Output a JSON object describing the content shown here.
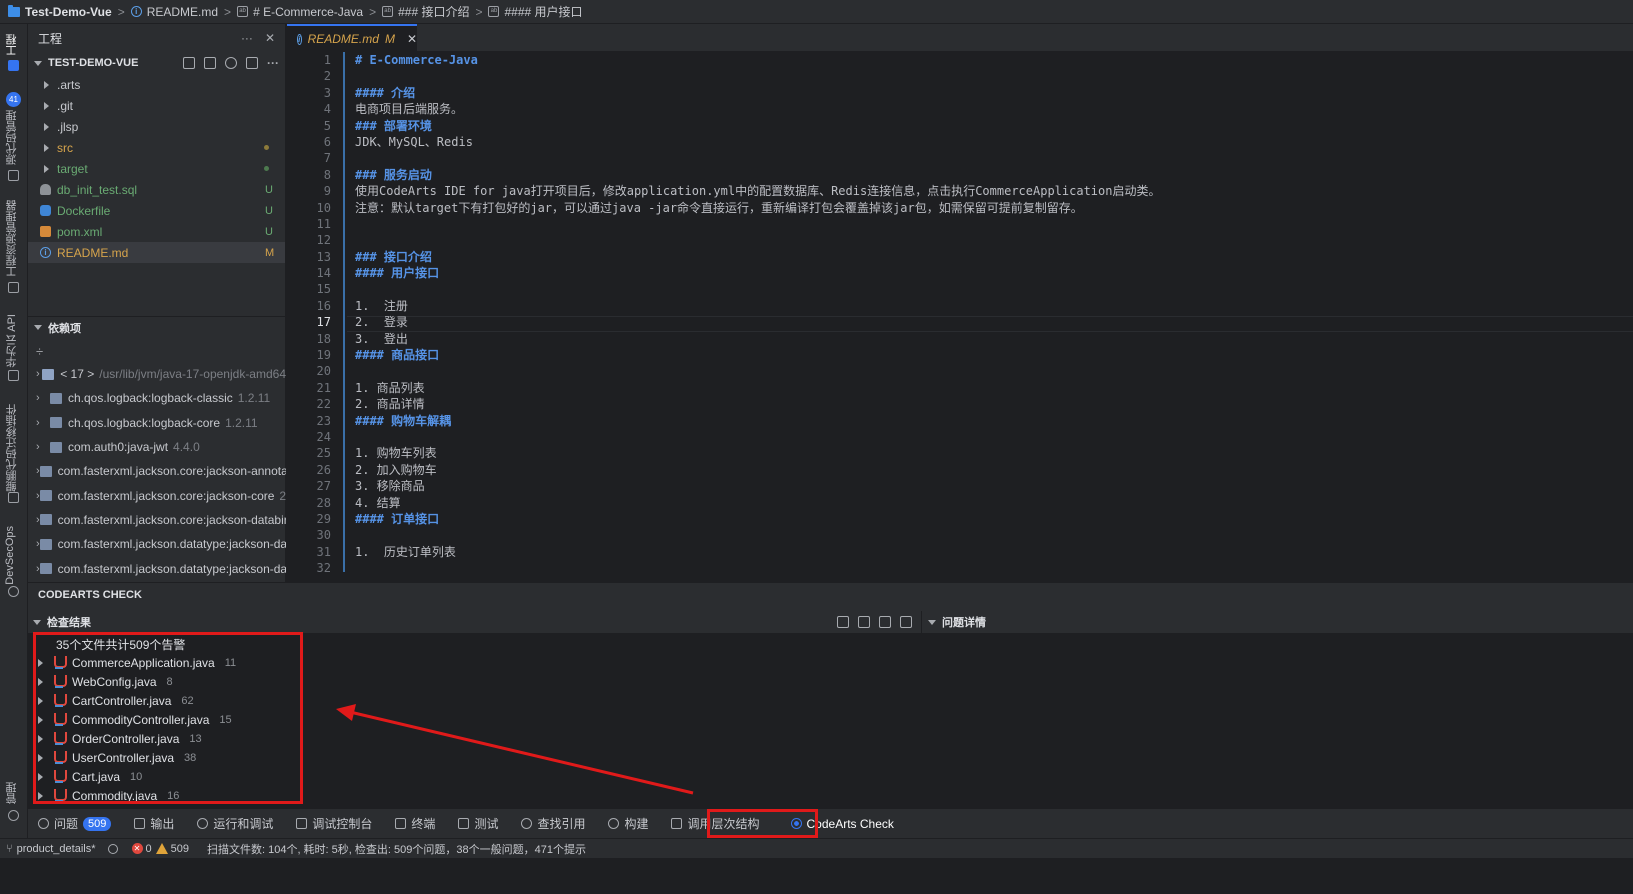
{
  "breadcrumb": {
    "root": "Test-Demo-Vue",
    "items": [
      "README.md",
      "# E-Commerce-Java",
      "### 接口介绍",
      "#### 用户接口"
    ]
  },
  "activity": {
    "project_label": "工程",
    "scm_label": "源代码管理",
    "scm_badge": "41",
    "resource_label": "工程资源管理器",
    "api_label": "华为云 API",
    "migrate_label": "鲲鹏代码迁移插件",
    "devsecops_label": "DevSecOps",
    "manage_label": "管理"
  },
  "project": {
    "title": "工程",
    "more": "···",
    "close": "✕",
    "root": "TEST-DEMO-VUE",
    "root_more": "···",
    "files": [
      {
        "name": ".arts",
        "badge": ""
      },
      {
        "name": ".git",
        "badge": ""
      },
      {
        "name": ".jlsp",
        "badge": ""
      },
      {
        "name": "src",
        "badge": ""
      },
      {
        "name": "target",
        "badge": ""
      },
      {
        "name": "db_init_test.sql",
        "badge": "U"
      },
      {
        "name": "Dockerfile",
        "badge": "U"
      },
      {
        "name": "pom.xml",
        "badge": "U"
      },
      {
        "name": "README.md",
        "badge": "M"
      }
    ],
    "deps_title": "依赖项",
    "deps_tool": "÷",
    "deps": [
      {
        "name": "< 17 >",
        "ver": "/usr/lib/jvm/java-17-openjdk-amd64"
      },
      {
        "name": "ch.qos.logback:logback-classic",
        "ver": "1.2.11"
      },
      {
        "name": "ch.qos.logback:logback-core",
        "ver": "1.2.11"
      },
      {
        "name": "com.auth0:java-jwt",
        "ver": "4.4.0"
      },
      {
        "name": "com.fasterxml.jackson.core:jackson-annota",
        "ver": ""
      },
      {
        "name": "com.fasterxml.jackson.core:jackson-core",
        "ver": "2."
      },
      {
        "name": "com.fasterxml.jackson.core:jackson-databir",
        "ver": ""
      },
      {
        "name": "com.fasterxml.jackson.datatype:jackson-da",
        "ver": ""
      },
      {
        "name": "com.fasterxml.jackson.datatype:jackson-da",
        "ver": ""
      }
    ]
  },
  "tab": {
    "label": "README.md",
    "status": "M",
    "close": "✕"
  },
  "editor": {
    "current_line": 17,
    "lines": [
      "# E-Commerce-Java",
      "",
      "#### 介绍",
      "电商项目后端服务。",
      "### 部署环境",
      "JDK、MySQL、Redis",
      "",
      "### 服务启动",
      "使用CodeArts IDE for java打开项目后，修改application.yml中的配置数据库、Redis连接信息，点击执行CommerceApplication启动类。",
      "注意：默认target下有打包好的jar，可以通过java -jar命令直接运行，重新编译打包会覆盖掉该jar包，如需保留可提前复制留存。",
      "",
      "",
      "### 接口介绍",
      "#### 用户接口",
      "",
      "1.  注册",
      "2.  登录",
      "3.  登出",
      "#### 商品接口",
      "",
      "1. 商品列表",
      "2. 商品详情",
      "#### 购物车解耦",
      "",
      "1. 购物车列表",
      "2. 加入购物车",
      "3. 移除商品",
      "4. 结算",
      "#### 订单接口",
      "",
      "1.  历史订单列表",
      ""
    ]
  },
  "check": {
    "title": "CODEARTS CHECK",
    "results_title": "检查结果",
    "detail_title": "问题详情",
    "summary": "35个文件共计509个告警",
    "results": [
      {
        "file": "CommerceApplication.java",
        "count": "11"
      },
      {
        "file": "WebConfig.java",
        "count": "8"
      },
      {
        "file": "CartController.java",
        "count": "62"
      },
      {
        "file": "CommodityController.java",
        "count": "15"
      },
      {
        "file": "OrderController.java",
        "count": "13"
      },
      {
        "file": "UserController.java",
        "count": "38"
      },
      {
        "file": "Cart.java",
        "count": "10"
      },
      {
        "file": "Commodity.java",
        "count": "16"
      }
    ]
  },
  "toolbar": {
    "problems": "问题",
    "problems_count": "509",
    "output": "输出",
    "run_debug": "运行和调试",
    "debug_console": "调试控制台",
    "terminal": "终端",
    "test": "测试",
    "find_refs": "查找引用",
    "build": "构建",
    "call_hierarchy": "调用层次结构",
    "codearts_check": "CodeArts Check"
  },
  "status": {
    "branch": "product_details*",
    "errors": "0",
    "warnings": "509",
    "scan_info": "扫描文件数: 104个, 耗时: 5秒, 检查出: 509个问题，38个一般问题，471个提示"
  },
  "colors": {
    "accent": "#3574f0",
    "highlight": "#e01a1a",
    "heading": "#5693e6",
    "modified": "#d6a44c",
    "untracked": "#6aab73"
  }
}
